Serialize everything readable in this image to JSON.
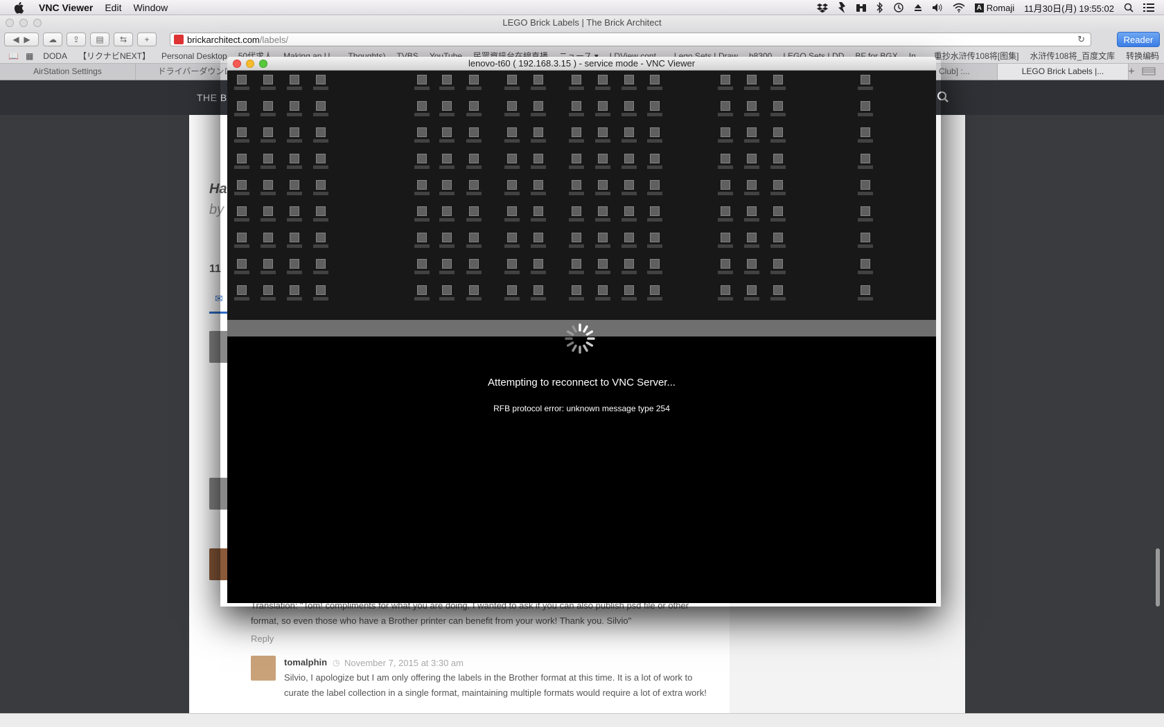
{
  "menubar": {
    "app_name": "VNC Viewer",
    "menus": [
      "Edit",
      "Window"
    ],
    "input_method": "Romaji",
    "clock": "11月30日(月)  19:55:02"
  },
  "safari": {
    "window_title": "LEGO Brick Labels | The Brick Architect",
    "url_domain": "brickarchitect.com",
    "url_path": "/labels/",
    "reader_label": "Reader",
    "bookmarks": [
      "DODA",
      "【リクナビNEXT】",
      "Personal Desktop",
      "50代求人",
      "Making an U...",
      "Thoughts)",
      "TVBS",
      "YouTube",
      "民眾資訊台在線直播",
      "ニュース ▾",
      "LDView cont...",
      "Lego Sets LDraw",
      "b8300",
      "LEGO Sets LDD",
      "BF for BGX",
      "In...",
      "重抄水浒传108将[图集]",
      "水浒传108将_百度文库",
      "转换编码"
    ],
    "tabs": [
      {
        "label": "AirStation Settings"
      },
      {
        "label": "ドライバーダウンロード"
      },
      {
        "label": "Club] :..."
      },
      {
        "label": "LEGO Brick Labels |..."
      }
    ]
  },
  "website": {
    "brand_fragment": "THE BR",
    "heading_fragment": "Ha",
    "byline_fragment": "by",
    "comments_count_fragment": "11",
    "translation_comment": "Translation: \"Tom! compliments for what you are doing. I wanted to ask if you can also publish psd file or other format, so even those who have a Brother printer can benefit from your work! Thank you. Silvio\"",
    "reply_label": "Reply",
    "reply_author": "tomalphin",
    "reply_date": "November 7, 2015 at 3:30 am",
    "reply_text": "Silvio, I apologize but I am only offering the labels in the Brother format at this time. It is a lot of work to curate the label collection in a single format, maintaining multiple formats would require a lot of extra work!"
  },
  "vnc": {
    "window_title": "lenovo-t60 ( 192.168.3.15 ) - service mode - VNC Viewer",
    "status": "Attempting to reconnect to VNC Server...",
    "error": "RFB protocol error: unknown message type 254"
  }
}
